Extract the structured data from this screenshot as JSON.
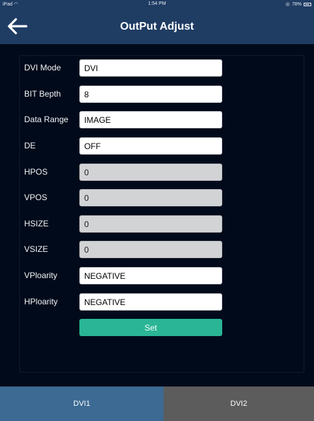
{
  "status_bar": {
    "device": "iPad",
    "time": "1:54 PM",
    "battery": "78%"
  },
  "header": {
    "title": "OutPut Adjust",
    "back_icon": "arrow-left-icon"
  },
  "form": {
    "fields": [
      {
        "label": "DVI Mode",
        "value": "DVI",
        "disabled": false
      },
      {
        "label": "BIT Bepth",
        "value": "8",
        "disabled": false
      },
      {
        "label": "Data Range",
        "value": "IMAGE",
        "disabled": false
      },
      {
        "label": "DE",
        "value": "OFF",
        "disabled": false
      },
      {
        "label": "HPOS",
        "value": "0",
        "disabled": true
      },
      {
        "label": "VPOS",
        "value": "0",
        "disabled": true
      },
      {
        "label": "HSIZE",
        "value": "0",
        "disabled": true
      },
      {
        "label": "VSIZE",
        "value": "0",
        "disabled": true
      },
      {
        "label": "VPloarity",
        "value": "NEGATIVE",
        "disabled": false
      },
      {
        "label": "HPloarity",
        "value": "NEGATIVE",
        "disabled": false
      }
    ],
    "set_label": "Set"
  },
  "tabs": [
    {
      "label": "DVI1",
      "selected": true
    },
    {
      "label": "DVI2",
      "selected": false
    }
  ],
  "colors": {
    "background": "#010a1a",
    "header": "#1f3c63",
    "set_button": "#29b596",
    "tab_active": "#3c6a93",
    "tab_inactive": "#5c5c5c",
    "field_disabled": "#d2d3d5"
  }
}
